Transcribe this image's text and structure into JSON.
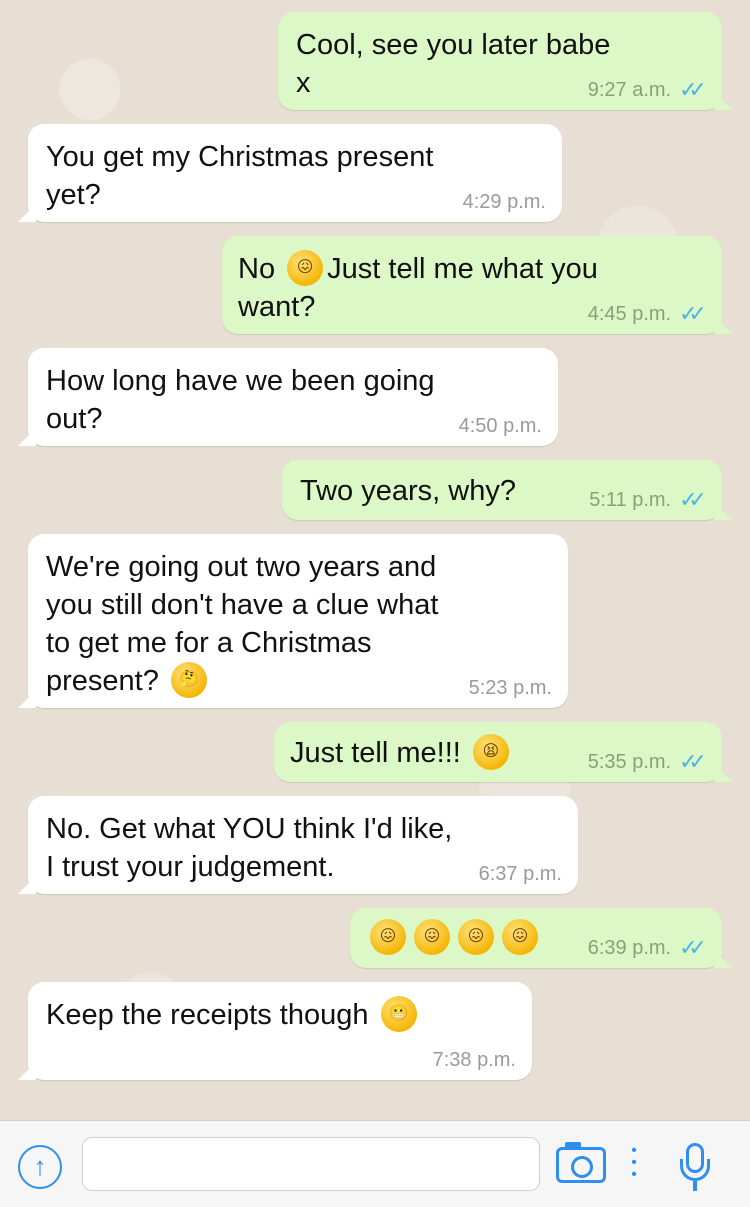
{
  "messages": [
    {
      "dir": "out",
      "text": "Cool, see you later babe\nx",
      "time": "9:27 a.m.",
      "ticks": "✓✓"
    },
    {
      "dir": "in",
      "text": "You get my Christmas present\nyet?",
      "time": "4:29 p.m."
    },
    {
      "dir": "out",
      "parts": [
        "No ",
        "Just tell me what you\nwant?"
      ],
      "time": "4:45 p.m.",
      "ticks": "✓✓"
    },
    {
      "dir": "in",
      "text": "How long have we been going\nout?",
      "time": "4:50 p.m."
    },
    {
      "dir": "out",
      "text": "Two years, why?",
      "time": "5:11 p.m.",
      "ticks": "✓✓"
    },
    {
      "dir": "in",
      "text": "We're going out two years and\nyou still don't have a clue what\nto get me for a Christmas\npresent? ",
      "time": "5:23 p.m."
    },
    {
      "dir": "out",
      "text": "Just tell me!!! ",
      "time": "5:35 p.m.",
      "ticks": "✓✓"
    },
    {
      "dir": "in",
      "text": "No. Get what YOU think I'd like,\nI trust your judgement.",
      "time": "6:37 p.m."
    },
    {
      "dir": "out",
      "text": "",
      "time": "6:39 p.m.",
      "ticks": "✓✓"
    },
    {
      "dir": "in",
      "text": "Keep the receipts though ",
      "time": "7:38 p.m."
    }
  ],
  "emoji_names": {
    "m3": "confounded-face-emoji",
    "m6": "thinking-face-emoji",
    "m7": "tired-face-emoji",
    "m9": "confounded-face-emoji",
    "m10": "grimacing-face-emoji"
  },
  "composer": {
    "upload_icon": "arrow-up-circle-icon",
    "camera_icon": "camera-icon",
    "more_icon": "vertical-dots-icon",
    "mic_icon": "microphone-icon",
    "accent": "#2f8ff0"
  },
  "colors": {
    "incoming_bubble": "#ffffff",
    "outgoing_bubble": "#dcf8c6",
    "read_ticks": "#4fb3e8",
    "chat_background": "#e7dfd4"
  }
}
